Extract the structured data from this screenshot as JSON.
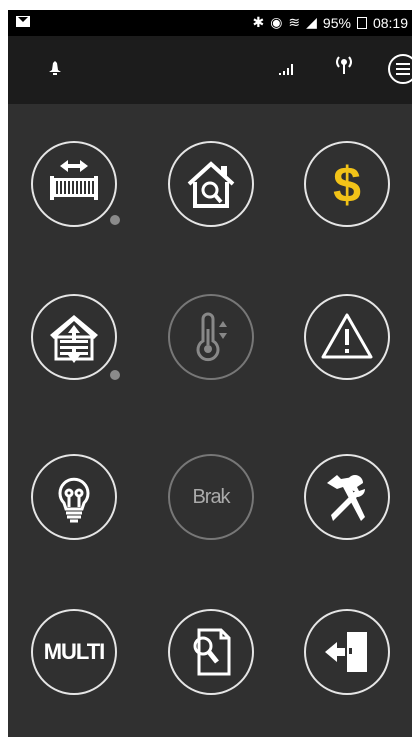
{
  "status_bar": {
    "battery": "95%",
    "time": "08:19"
  },
  "grid": {
    "items": [
      {
        "name": "gate-icon"
      },
      {
        "name": "house-search-icon"
      },
      {
        "name": "dollar-icon",
        "color": "#f2c318"
      },
      {
        "name": "garage-door-icon"
      },
      {
        "name": "thermometer-icon"
      },
      {
        "name": "warning-icon"
      },
      {
        "name": "lightbulb-icon"
      },
      {
        "name": "brak-label",
        "label": "Brak"
      },
      {
        "name": "tools-icon"
      },
      {
        "name": "multi-label",
        "label": "MULTI"
      },
      {
        "name": "document-search-icon"
      },
      {
        "name": "exit-door-icon"
      }
    ]
  }
}
